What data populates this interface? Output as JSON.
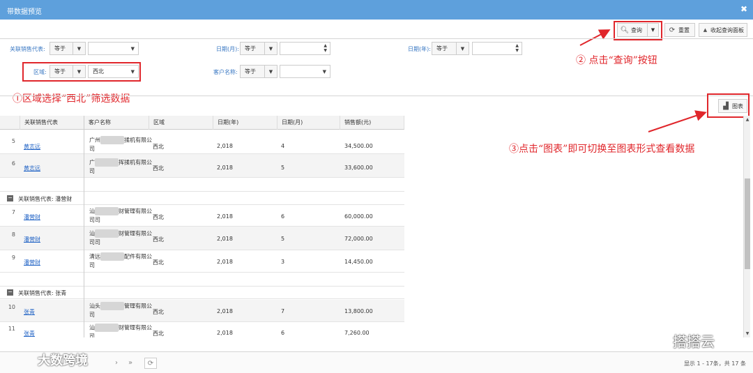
{
  "window": {
    "title": "带数据预览"
  },
  "toolbar": {
    "query_label": "查询",
    "reset_label": "重置",
    "collapse_label": "收起查询面板"
  },
  "filters": {
    "op_label": "等于",
    "sales_rep_label": "关联销售代表:",
    "date_month_label": "日期(月):",
    "date_year_label": "日期(年):",
    "region_label": "区域:",
    "region_value": "西北",
    "customer_label": "客户名称:"
  },
  "annotations": {
    "step1": "①区域选择“西北”筛选数据",
    "step2": "② 点击“查询”按钮",
    "step3": "③点击“图表”即可切换至图表形式查看数据"
  },
  "chart_button": {
    "label": "图表"
  },
  "grid": {
    "columns": [
      "关联销售代表",
      "客户名称",
      "区域",
      "日期(年)",
      "日期(月)",
      "销售额(元)"
    ],
    "groups": [
      {
        "title": "关联销售代表: 潘营财"
      },
      {
        "title": "关联销售代表: 张青"
      }
    ],
    "rows": [
      {
        "n": "5",
        "rep": "黄志远",
        "cust_a": "广州",
        "cust_b": "揉机有限公司",
        "region": "西北",
        "year": "2,018",
        "month": "4",
        "amount": "34,500.00"
      },
      {
        "n": "6",
        "rep": "黄志远",
        "cust_a": "广",
        "cust_b": "挥揉机有限公司",
        "region": "西北",
        "year": "2,018",
        "month": "5",
        "amount": "33,600.00"
      },
      {
        "n": "7",
        "rep": "潘营财",
        "cust_a": "汕",
        "cust_b": "财管理有限公司",
        "region": "西北",
        "year": "2,018",
        "month": "6",
        "amount": "60,000.00"
      },
      {
        "n": "8",
        "rep": "潘营财",
        "cust_a": "汕",
        "cust_b": "财管理有限公司",
        "region": "西北",
        "year": "2,018",
        "month": "5",
        "amount": "72,000.00"
      },
      {
        "n": "9",
        "rep": "潘营财",
        "cust_a": "清远",
        "cust_b": "配件有限公",
        "region": "西北",
        "year": "2,018",
        "month": "3",
        "amount": "14,450.00"
      },
      {
        "n": "10",
        "rep": "张青",
        "cust_a": "汕头",
        "cust_b": "管理有限公",
        "region": "西北",
        "year": "2,018",
        "month": "7",
        "amount": "13,800.00"
      },
      {
        "n": "11",
        "rep": "张青",
        "cust_a": "汕",
        "cust_b": "财管理有限公",
        "region": "西北",
        "year": "2,018",
        "month": "6",
        "amount": "7,260.00"
      }
    ],
    "cust_tail": "司"
  },
  "pager": {
    "info": "显示 1 - 17条，共 17 条"
  },
  "watermarks": {
    "left": "大数跨境",
    "right": "搭搭云"
  }
}
